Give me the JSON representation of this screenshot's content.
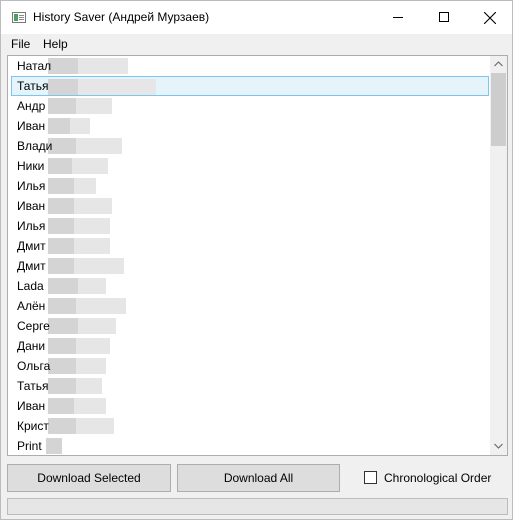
{
  "window": {
    "title": "History Saver (Андрей Мурзаев)",
    "app_icon": "history-saver-icon",
    "controls": [
      "minimize-icon",
      "maximize-icon",
      "close-icon"
    ]
  },
  "menu": {
    "file": "File",
    "help": "Help"
  },
  "contacts": {
    "selected_index": 1,
    "items": [
      "Натал",
      "Татья",
      "Андр",
      "Иван",
      "Влади",
      "Ники",
      "Илья",
      "Иван",
      "Илья",
      "Дмит",
      "Дмит",
      "Lada",
      "Алён",
      "Серге",
      "Дани",
      "Ольга",
      "Татья",
      "Иван",
      "Крист",
      "Print"
    ]
  },
  "actions": {
    "download_selected": "Download Selected",
    "download_all": "Download All",
    "chronological_order_label": "Chronological Order",
    "chronological_order_checked": false
  },
  "colors": {
    "selection_background": "#e5f3fb",
    "selection_border": "#7ec4ec",
    "button_face": "#dddddd"
  }
}
